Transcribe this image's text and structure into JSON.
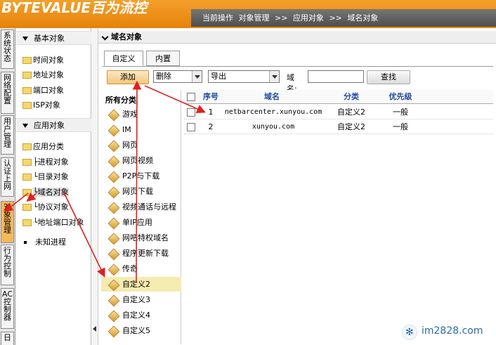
{
  "header": {
    "logo_text": "BYTEVALUE百为流控",
    "breadcrumb": [
      "当前操作",
      "对象管理",
      ">>",
      "应用对象",
      ">>",
      "域名对象"
    ]
  },
  "colors": {
    "header_orange": "#e7830a",
    "accent_add_button": "#f4c67c",
    "arrow_red": "#e02020",
    "table_header_text": "#1e4a9e"
  },
  "vertical_menu": [
    {
      "label": "系统状态",
      "active": false
    },
    {
      "label": "网络配置",
      "active": false
    },
    {
      "label": "用户管理",
      "active": false
    },
    {
      "label": "认证上网",
      "active": false
    },
    {
      "label": "对象管理",
      "active": true
    },
    {
      "label": "行为控制",
      "active": false
    },
    {
      "label": "AC控制器",
      "active": false
    },
    {
      "label": "日",
      "active": false
    }
  ],
  "tree": {
    "basic_section": "基本对象",
    "basic_items": [
      "时间对象",
      "地址对象",
      "端口对象",
      "ISP对象"
    ],
    "app_section": "应用对象",
    "app_items": [
      "应用分类",
      "├进程对象",
      "└目录对象",
      "└域名对象",
      "└协议对象",
      "└地址端口对象"
    ],
    "unknown": "未知进程"
  },
  "main": {
    "title": "域名对象",
    "tabs": [
      "自定义",
      "内置"
    ],
    "toolbar": {
      "add_label": "添加",
      "delete_select": "删除",
      "export_select": "导出",
      "domain_label": "域名:",
      "domain_value": "",
      "search_label": "查找"
    },
    "categories": {
      "header": "所有分类",
      "items": [
        "游戏",
        "IM",
        "网页",
        "网页视频",
        "P2P与下载",
        "网页下载",
        "视频通话与远程",
        "单IP应用",
        "网吧特权域名",
        "程序更新下载",
        "传奇",
        "自定义2",
        "自定义3",
        "自定义4",
        "自定义5"
      ],
      "selected": "自定义2"
    },
    "table": {
      "headers": [
        "序号",
        "域名",
        "分类",
        "优先级"
      ],
      "rows": [
        {
          "index": "1",
          "domain": "netbarcenter.xunyou.com",
          "category": "自定义2",
          "priority": "一般"
        },
        {
          "index": "2",
          "domain": "xunyou.com",
          "category": "自定义2",
          "priority": "一般"
        }
      ]
    }
  },
  "watermark": {
    "text": "im2828.com",
    "icon": "snowflake-icon"
  }
}
